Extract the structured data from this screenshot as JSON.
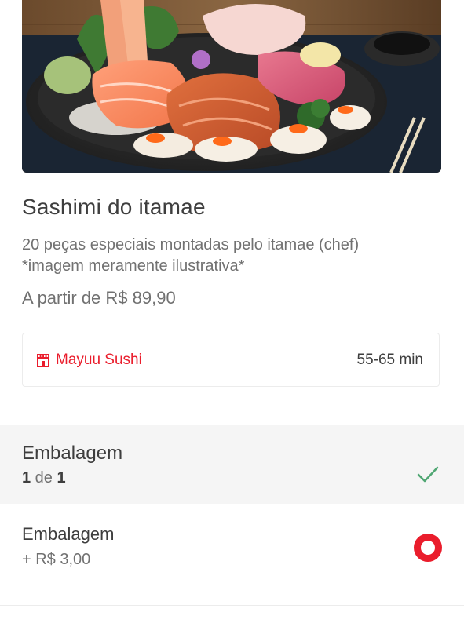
{
  "product": {
    "title": "Sashimi do itamae",
    "description": "20 peças especiais montadas pelo itamae (chef)\n*imagem meramente ilustrativa*",
    "price": "A partir de R$ 89,90"
  },
  "restaurant": {
    "name": "Mayuu Sushi",
    "delivery_time": "55-65 min",
    "icon": "store-icon"
  },
  "section": {
    "title": "Embalagem",
    "count_current": "1",
    "count_sep": " de ",
    "count_total": "1",
    "status_icon": "check-icon"
  },
  "option": {
    "name": "Embalagem",
    "price": "+ R$ 3,00",
    "selected": true
  },
  "colors": {
    "brand": "#ea1d2c",
    "check": "#50a773",
    "text": "#3e3e3e",
    "muted": "#717171"
  }
}
